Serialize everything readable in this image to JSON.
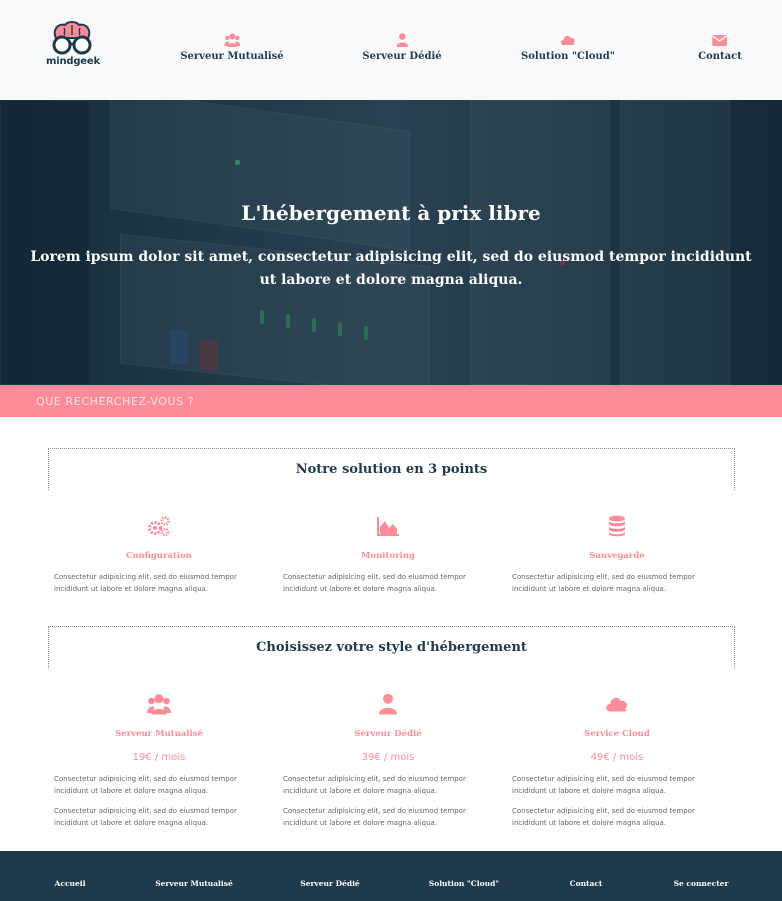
{
  "header": {
    "logo_text": "mindgeek",
    "nav": [
      {
        "label": "Serveur Mutualisé",
        "icon": "users-icon"
      },
      {
        "label": "Serveur Dédié",
        "icon": "user-icon"
      },
      {
        "label": "Solution \"Cloud\"",
        "icon": "cloud-icon"
      },
      {
        "label": "Contact",
        "icon": "envelope-icon"
      }
    ]
  },
  "hero": {
    "title": "L'hébergement à prix libre",
    "subtitle": "Lorem ipsum dolor sit amet, consectetur adipisicing elit, sed do eiusmod tempor incididunt ut labore et dolore magna aliqua."
  },
  "search": {
    "placeholder": "QUE RECHERCHEZ-VOUS ?"
  },
  "features": {
    "title": "Notre solution en 3 points",
    "items": [
      {
        "title": "Configuration",
        "icon": "gears-icon",
        "text": "Consectetur adipisicing elit, sed do eiusmod tempor incididunt ut labore et dolore magna aliqua."
      },
      {
        "title": "Monitoring",
        "icon": "area-chart-icon",
        "text": "Consectetur adipisicing elit, sed do eiusmod tempor incididunt ut labore et dolore magna aliqua."
      },
      {
        "title": "Sauvegarde",
        "icon": "database-icon",
        "text": "Consectetur adipisicing elit, sed do eiusmod tempor incididunt ut labore et dolore magna aliqua."
      }
    ]
  },
  "plans": {
    "title": "Choisissez votre style d'hébergement",
    "items": [
      {
        "title": "Serveur Mutualisé",
        "icon": "users-icon",
        "price": "19€ / mois",
        "text1": "Consectetur adipisicing elit, sed do eiusmod tempor incididunt ut labore et dolore magna aliqua.",
        "text2": "Consectetur adipisicing elit, sed do eiusmod tempor incididunt ut labore et dolore magna aliqua."
      },
      {
        "title": "Serveur Dédié",
        "icon": "user-icon",
        "price": "39€ / mois",
        "text1": "Consectetur adipisicing elit, sed do eiusmod tempor incididunt ut labore et dolore magna aliqua.",
        "text2": "Consectetur adipisicing elit, sed do eiusmod tempor incididunt ut labore et dolore magna aliqua."
      },
      {
        "title": "Service Cloud",
        "icon": "cloud-icon",
        "price": "49€ / mois",
        "text1": "Consectetur adipisicing elit, sed do eiusmod tempor incididunt ut labore et dolore magna aliqua.",
        "text2": "Consectetur adipisicing elit, sed do eiusmod tempor incididunt ut labore et dolore magna aliqua."
      }
    ]
  },
  "footer": {
    "links": [
      "Accueil",
      "Serveur Mutualisé",
      "Serveur Dédié",
      "Solution \"Cloud\"",
      "Contact",
      "Se connecter"
    ]
  },
  "colors": {
    "accent": "#fd8c98",
    "dark": "#1f3a4d",
    "header_bg": "#f8f9fa"
  }
}
